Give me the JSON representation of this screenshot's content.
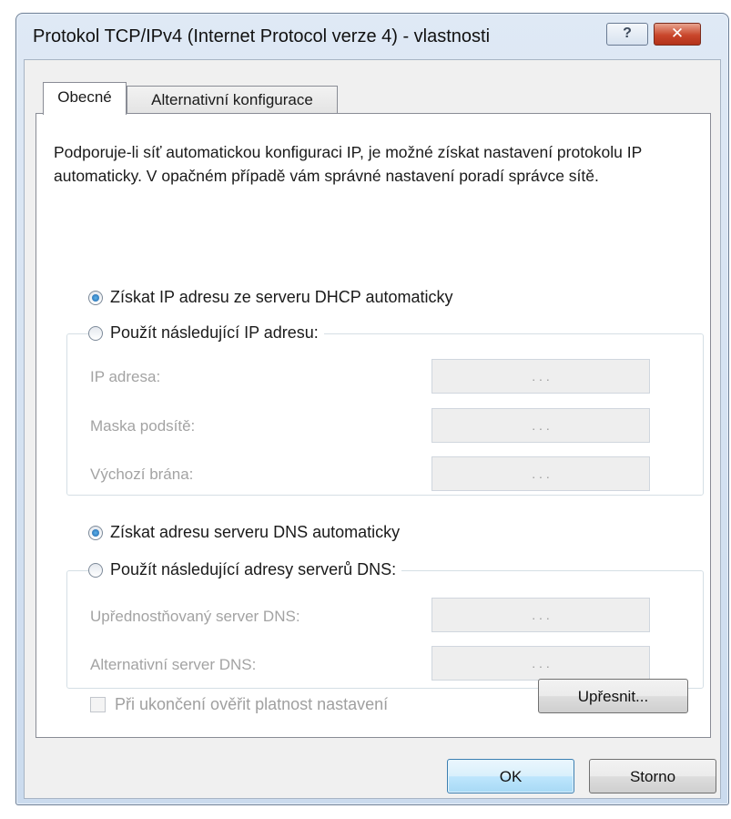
{
  "window": {
    "title": "Protokol TCP/IPv4 (Internet Protocol verze 4) - vlastnosti",
    "help_label": "?",
    "close_label": "✕"
  },
  "tabs": [
    {
      "label": "Obecné",
      "selected": true
    },
    {
      "label": "Alternativní konfigurace",
      "selected": false
    }
  ],
  "description": "Podporuje-li síť automatickou konfiguraci IP, je možné získat nastavení protokolu IP automaticky. V opačném případě vám správné nastavení poradí správce sítě.",
  "ip_section": {
    "auto_label": "Získat IP adresu ze serveru DHCP automaticky",
    "auto_checked": true,
    "manual_label": "Použít následující IP adresu:",
    "manual_checked": false,
    "fields": [
      {
        "label": "IP adresa:",
        "value": ". . ."
      },
      {
        "label": "Maska podsítě:",
        "value": ". . ."
      },
      {
        "label": "Výchozí brána:",
        "value": ". . ."
      }
    ]
  },
  "dns_section": {
    "auto_label": "Získat adresu serveru DNS automaticky",
    "auto_checked": true,
    "manual_label": "Použít následující adresy serverů DNS:",
    "manual_checked": false,
    "fields": [
      {
        "label": "Upřednostňovaný server DNS:",
        "value": ". . ."
      },
      {
        "label": "Alternativní server DNS:",
        "value": ". . ."
      }
    ]
  },
  "validate_checkbox": {
    "label": "Při ukončení ověřit platnost nastavení",
    "checked": false,
    "enabled": false
  },
  "buttons": {
    "advanced": "Upřesnit...",
    "ok": "OK",
    "cancel": "Storno"
  },
  "colors": {
    "title_bar": "#cbdbee",
    "close_button": "#c9462b",
    "ok_button_highlight": "#bee6fd",
    "disabled_text": "#a3a3a3"
  }
}
